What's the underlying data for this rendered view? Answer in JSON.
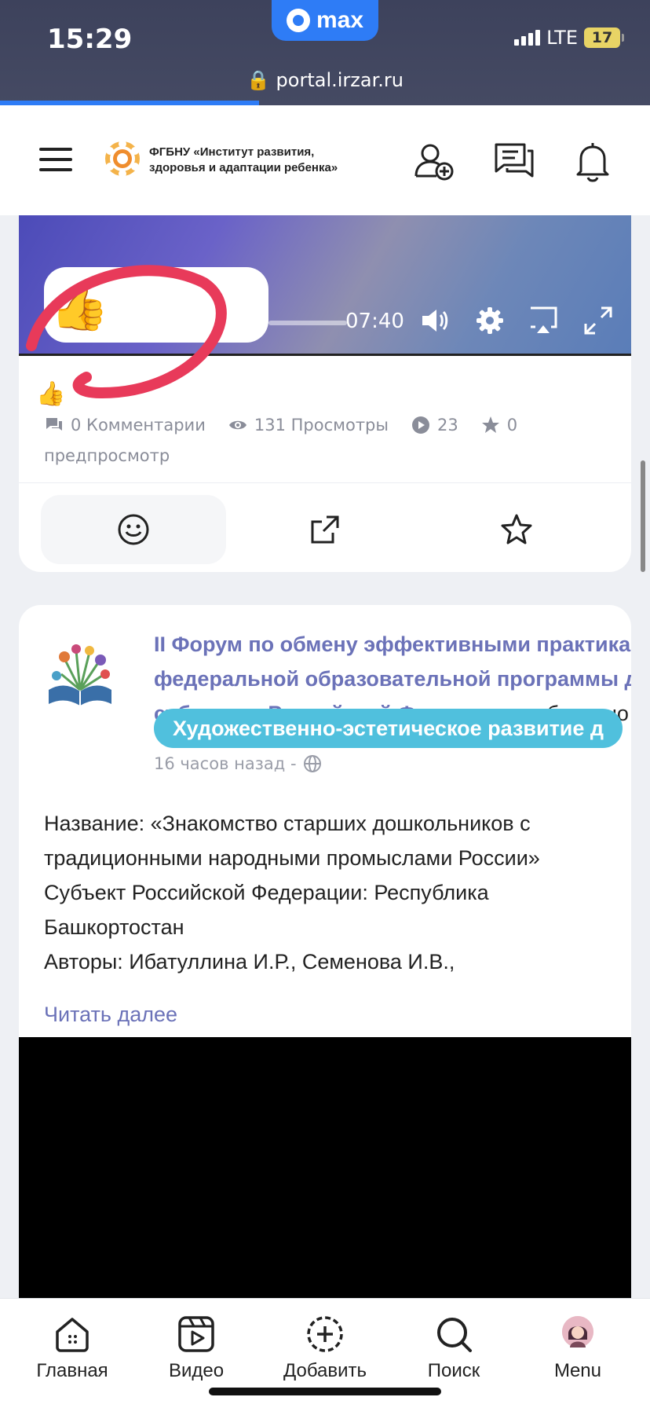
{
  "status_bar": {
    "time": "15:29",
    "app_badge": "max",
    "network": "LTE",
    "battery": "17",
    "url": "portal.irzar.ru"
  },
  "header": {
    "org_name_line1": "ФГБНУ «Институт развития,",
    "org_name_line2": "здоровья и адаптации ребенка»"
  },
  "post1": {
    "video_time": "07:40",
    "stats": {
      "comments": "0 Комментарии",
      "views": "131 Просмотры",
      "plays": "23",
      "stars": "0"
    },
    "preview_label": "предпросмотр"
  },
  "post2": {
    "title_line1": "II Форум по обмену эффективными практиками",
    "title_line2": "федеральной образовательной программы д",
    "title_line3": "субъектах Российской Федерации",
    "added_text": " добавлено",
    "tag": "Художественно-эстетическое развитие д",
    "time_ago": "16 часов назад -",
    "body": [
      "Название: «Знакомство старших дошкольников с",
      "традиционными народными промыслами России»",
      "Субъект Российской Федерации: Республика",
      "Башкортостан",
      "Авторы: Ибатуллина И.Р., Семенова И.В.,"
    ],
    "read_more": "Читать далее"
  },
  "nav": {
    "home": "Главная",
    "video": "Видео",
    "add": "Добавить",
    "search": "Поиск",
    "menu": "Menu"
  },
  "colors": {
    "accent": "#2e7cf6",
    "link": "#6b72b8",
    "tag": "#50c0dd",
    "annotation": "#e83a5a"
  }
}
